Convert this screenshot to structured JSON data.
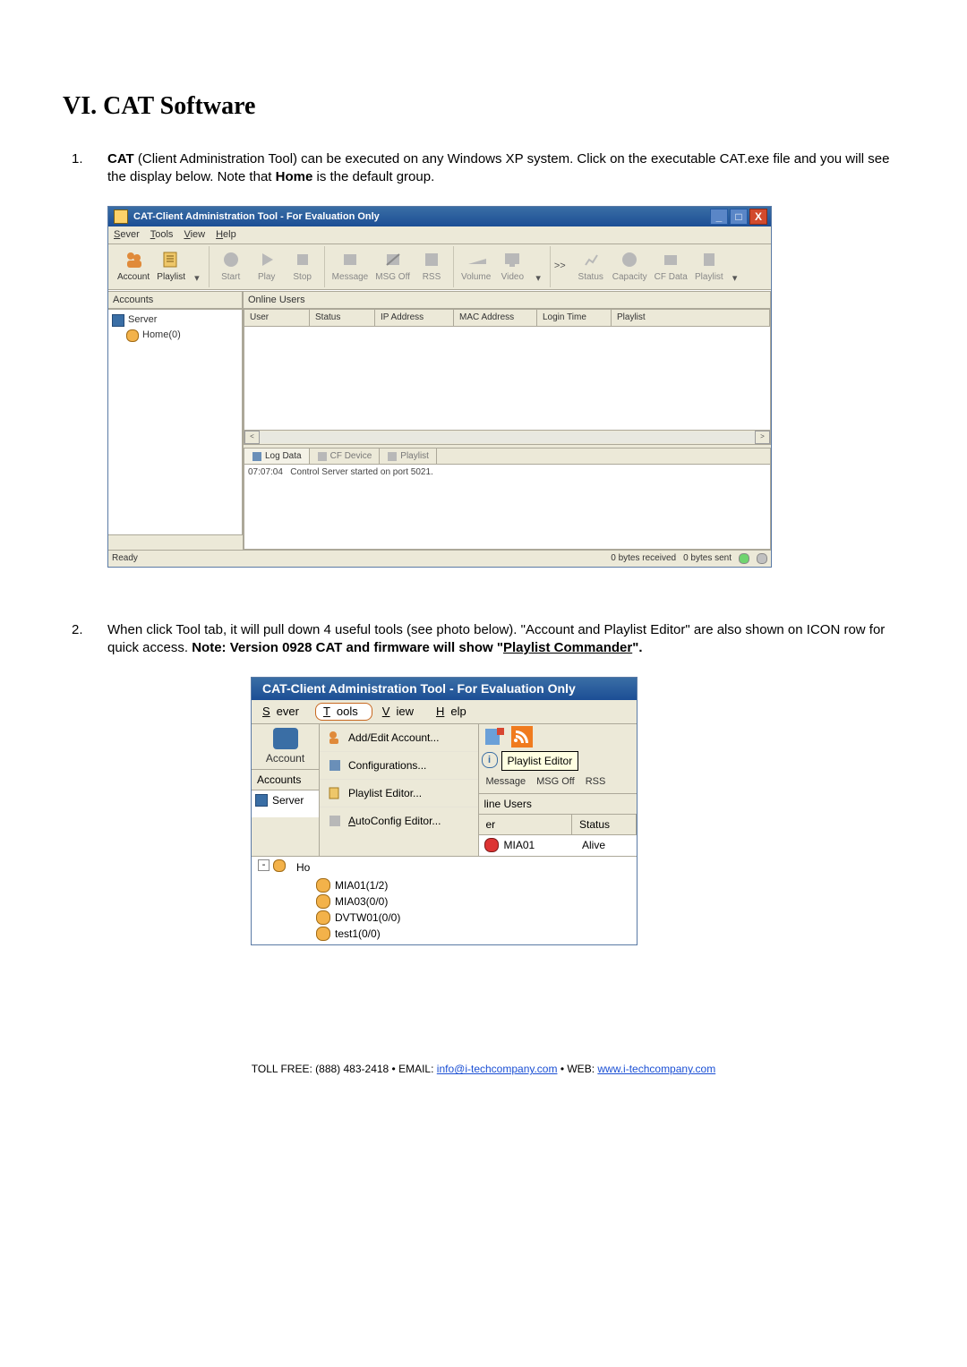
{
  "section_title": "VI. CAT Software",
  "items": [
    {
      "num": "1.",
      "html": "<b>CAT</b> (Client Administration Tool) can be executed on any Windows XP system. Click on the executable CAT.exe file and you will see the display below. Note that <b>Home</b> is the default group."
    },
    {
      "num": "2.",
      "html": "When click Tool tab, it will pull down 4 useful tools (see photo below). \"Account and Playlist Editor\" are also shown on ICON row for quick access. <b>Note: Version 0928 CAT and firmware will show \"<u>Playlist Commander</u>\".</b>"
    }
  ],
  "win1": {
    "title": "CAT-Client Administration Tool - For Evaluation Only",
    "menus": [
      "Sever",
      "Tools",
      "View",
      "Help"
    ],
    "toolbar": [
      {
        "group": "g1",
        "enabled": true,
        "items": [
          {
            "label": "Account",
            "icon": "people-icon"
          },
          {
            "label": "Playlist",
            "icon": "playlist-icon",
            "dropdown": true
          }
        ]
      },
      {
        "group": "g2",
        "items": [
          {
            "label": "Start",
            "icon": "start-icon"
          },
          {
            "label": "Play",
            "icon": "play-icon"
          },
          {
            "label": "Stop",
            "icon": "stop-icon"
          }
        ]
      },
      {
        "group": "g3",
        "items": [
          {
            "label": "Message",
            "icon": "message-icon"
          },
          {
            "label": "MSG Off",
            "icon": "msgoff-icon"
          },
          {
            "label": "RSS",
            "icon": "rss-icon"
          }
        ]
      },
      {
        "group": "g4",
        "items": [
          {
            "label": "Volume",
            "icon": "volume-icon"
          },
          {
            "label": "Video",
            "icon": "video-icon",
            "dropdown": true
          }
        ]
      },
      {
        "arrow": ">>"
      },
      {
        "group": "g5",
        "items": [
          {
            "label": "Status",
            "icon": "status-icon"
          },
          {
            "label": "Capacity",
            "icon": "capacity-icon"
          },
          {
            "label": "CF Data",
            "icon": "cfdata-icon"
          },
          {
            "label": "Playlist",
            "icon": "playlist2-icon",
            "dropdown": true
          }
        ]
      }
    ],
    "accounts_label": "Accounts",
    "online_users_label": "Online Users",
    "tree": {
      "root": "Server",
      "child": "Home(0)"
    },
    "grid_cols": [
      "User",
      "Status",
      "IP Address",
      "MAC Address",
      "Login Time",
      "Playlist"
    ],
    "log_tabs": [
      {
        "label": "Log Data",
        "icon": "log-icon",
        "active": true
      },
      {
        "label": "CF Device",
        "icon": "cf-icon"
      },
      {
        "label": "Playlist",
        "icon": "pl-icon"
      }
    ],
    "log_line": {
      "time": "07:07:04",
      "text": "Control Server started on port 5021."
    },
    "status": {
      "ready": "Ready",
      "recv": "0 bytes received",
      "sent": "0 bytes sent"
    }
  },
  "win2": {
    "title": "CAT-Client Administration Tool - For Evaluation Only",
    "menus": [
      "Sever",
      "Tools",
      "View",
      "Help"
    ],
    "selected_menu": "Tools",
    "menu_items": [
      {
        "label": "Add/Edit Account...",
        "icon": "account-add-icon"
      },
      {
        "label": "Configurations...",
        "icon": "config-icon"
      },
      {
        "label": "Playlist Editor...",
        "icon": "pl-editor-icon"
      },
      {
        "label": "AutoConfig Editor...",
        "icon": "autoconfig-icon",
        "underline": "A"
      }
    ],
    "tooltip": "Playlist Editor",
    "left_label": "Account",
    "accounts_label": "Accounts",
    "tb": [
      {
        "label": "Message",
        "icon": "message-icon"
      },
      {
        "label": "MSG Off",
        "icon": "msgoff-icon"
      },
      {
        "label": "RSS",
        "icon": "rss-icon"
      }
    ],
    "right_pane": {
      "title": "line Users",
      "cols": [
        "er",
        "Status"
      ],
      "row": {
        "name": "MIA01",
        "status": "Alive"
      }
    },
    "tree": {
      "root_label": "Server",
      "home_label": "Ho",
      "nodes": [
        "MIA01(1/2)",
        "MIA03(0/0)",
        "DVTW01(0/0)",
        "test1(0/0)"
      ]
    }
  },
  "footer": {
    "toll": "TOLL FREE: (888) 483-2418",
    "email_label": "EMAIL:",
    "email": "info@i-techcompany.com",
    "web_label": "WEB:",
    "web": "www.i-techcompany.com"
  }
}
